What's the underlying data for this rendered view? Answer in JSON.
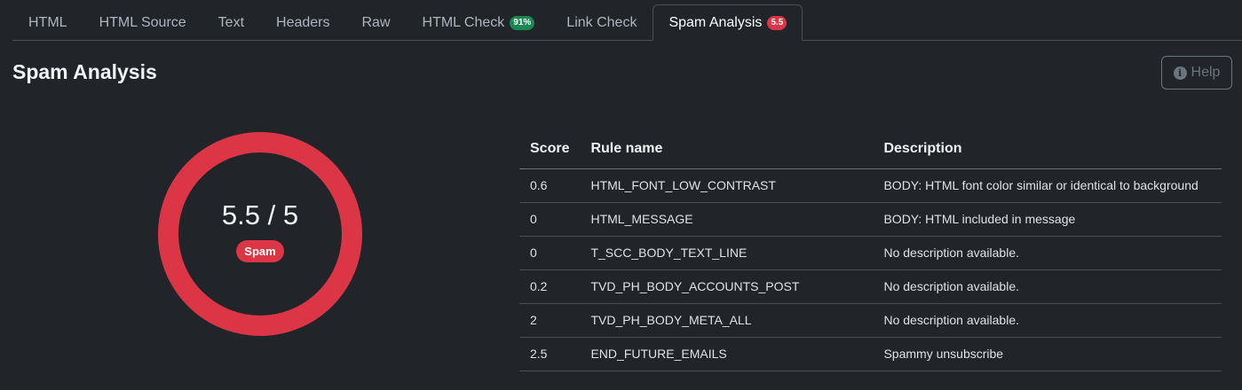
{
  "tabs": [
    {
      "label": "HTML"
    },
    {
      "label": "HTML Source"
    },
    {
      "label": "Text"
    },
    {
      "label": "Headers"
    },
    {
      "label": "Raw"
    },
    {
      "label": "HTML Check",
      "badge": "91%"
    },
    {
      "label": "Link Check"
    },
    {
      "label": "Spam Analysis",
      "badge": "5.5"
    }
  ],
  "colors": {
    "background": "#212529",
    "spam_red": "#dc3545",
    "success_green": "#198754",
    "muted": "#6c757d"
  },
  "header": {
    "title": "Spam Analysis",
    "help_label": "Help",
    "help_icon": "info-circle-icon"
  },
  "gauge": {
    "score_text": "5.5 / 5",
    "score": 5.5,
    "max": 5,
    "fill_fraction": 1.0,
    "status": "Spam"
  },
  "table": {
    "headers": {
      "score": "Score",
      "rule": "Rule name",
      "description": "Description"
    },
    "rows": [
      {
        "score": "0.6",
        "rule": "HTML_FONT_LOW_CONTRAST",
        "description": "BODY: HTML font color similar or identical to background"
      },
      {
        "score": "0",
        "rule": "HTML_MESSAGE",
        "description": "BODY: HTML included in message"
      },
      {
        "score": "0",
        "rule": "T_SCC_BODY_TEXT_LINE",
        "description": "No description available."
      },
      {
        "score": "0.2",
        "rule": "TVD_PH_BODY_ACCOUNTS_POST",
        "description": "No description available."
      },
      {
        "score": "2",
        "rule": "TVD_PH_BODY_META_ALL",
        "description": "No description available."
      },
      {
        "score": "2.5",
        "rule": "END_FUTURE_EMAILS",
        "description": "Spammy unsubscribe"
      }
    ]
  }
}
